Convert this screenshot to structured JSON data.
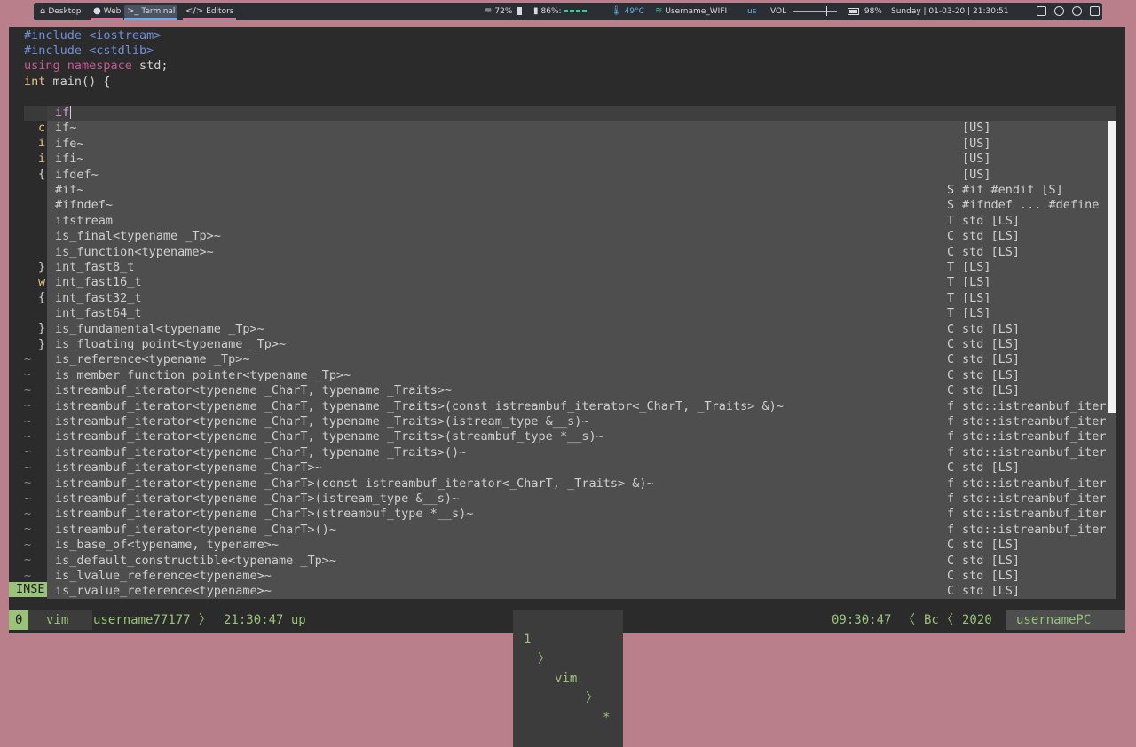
{
  "topbar": {
    "tags": [
      {
        "icon": "home-icon",
        "label": "Desktop",
        "underline": ""
      },
      {
        "icon": "globe-icon",
        "label": "Web",
        "underline": "#e06c9f"
      },
      {
        "icon": "terminal-icon",
        "label": "Terminal",
        "underline": "#61afef"
      },
      {
        "icon": "code-icon",
        "label": "Editors",
        "underline": "#e06c9f"
      }
    ],
    "disk": "72%",
    "memory": "86%:",
    "temperature": "49°C",
    "wifi": "Username_WIFI",
    "keyboard_layout": "us",
    "volume_label": "VOL",
    "battery": "98%",
    "datetime": "Sunday | 01-03-20 | 21:30:51"
  },
  "editor": {
    "lines": [
      {
        "a": "#include",
        "b": " <iostream>"
      },
      {
        "a": "#include",
        "b": " <cstdlib>"
      },
      {
        "a": "using",
        "ns": " namespace",
        "b": " std;"
      },
      {
        "a": "int",
        "b": " main() {"
      }
    ],
    "gutter": [
      "c",
      "i",
      "i",
      "{",
      "",
      "",
      "",
      "",
      "",
      "}",
      "w",
      "{",
      "",
      "}",
      "}",
      "~",
      "~",
      "~",
      "~",
      "~",
      "~",
      "~",
      "~",
      "~",
      "~",
      "~",
      "~",
      "~",
      "~",
      "~"
    ],
    "mode": "INSE"
  },
  "popup": {
    "typed": "if",
    "items": [
      {
        "word": "if~",
        "kind": "",
        "menu": "[US]"
      },
      {
        "word": "ife~",
        "kind": "",
        "menu": "[US]"
      },
      {
        "word": "ifi~",
        "kind": "",
        "menu": "[US]"
      },
      {
        "word": "ifdef~",
        "kind": "",
        "menu": "[US]"
      },
      {
        "word": "#if~",
        "kind": "S",
        "menu": "#if #endif [S]"
      },
      {
        "word": "#ifndef~",
        "kind": "S",
        "menu": "#ifndef ... #define"
      },
      {
        "word": "ifstream",
        "kind": "T",
        "menu": "std [LS]"
      },
      {
        "word": "is_final<typename _Tp>~",
        "kind": "C",
        "menu": "std [LS]"
      },
      {
        "word": "is_function<typename>~",
        "kind": "C",
        "menu": "std [LS]"
      },
      {
        "word": "int_fast8_t",
        "kind": "T",
        "menu": "[LS]"
      },
      {
        "word": "int_fast16_t",
        "kind": "T",
        "menu": "[LS]"
      },
      {
        "word": "int_fast32_t",
        "kind": "T",
        "menu": "[LS]"
      },
      {
        "word": "int_fast64_t",
        "kind": "T",
        "menu": "[LS]"
      },
      {
        "word": "is_fundamental<typename _Tp>~",
        "kind": "C",
        "menu": "std [LS]"
      },
      {
        "word": "is_floating_point<typename _Tp>~",
        "kind": "C",
        "menu": "std [LS]"
      },
      {
        "word": "is_reference<typename _Tp>~",
        "kind": "C",
        "menu": "std [LS]"
      },
      {
        "word": "is_member_function_pointer<typename _Tp>~",
        "kind": "C",
        "menu": "std [LS]"
      },
      {
        "word": "istreambuf_iterator<typename _CharT, typename _Traits>~",
        "kind": "C",
        "menu": "std [LS]"
      },
      {
        "word": "istreambuf_iterator<typename _CharT, typename _Traits>(const istreambuf_iterator<_CharT, _Traits> &)~",
        "kind": "f",
        "menu": "std::istreambuf_iter"
      },
      {
        "word": "istreambuf_iterator<typename _CharT, typename _Traits>(istream_type &__s)~",
        "kind": "f",
        "menu": "std::istreambuf_iter"
      },
      {
        "word": "istreambuf_iterator<typename _CharT, typename _Traits>(streambuf_type *__s)~",
        "kind": "f",
        "menu": "std::istreambuf_iter"
      },
      {
        "word": "istreambuf_iterator<typename _CharT, typename _Traits>()~",
        "kind": "f",
        "menu": "std::istreambuf_iter"
      },
      {
        "word": "istreambuf_iterator<typename _CharT>~",
        "kind": "C",
        "menu": "std [LS]"
      },
      {
        "word": "istreambuf_iterator<typename _CharT>(const istreambuf_iterator<_CharT, _Traits> &)~",
        "kind": "f",
        "menu": "std::istreambuf_iter"
      },
      {
        "word": "istreambuf_iterator<typename _CharT>(istream_type &__s)~",
        "kind": "f",
        "menu": "std::istreambuf_iter"
      },
      {
        "word": "istreambuf_iterator<typename _CharT>(streambuf_type *__s)~",
        "kind": "f",
        "menu": "std::istreambuf_iter"
      },
      {
        "word": "istreambuf_iterator<typename _CharT>()~",
        "kind": "f",
        "menu": "std::istreambuf_iter"
      },
      {
        "word": "is_base_of<typename, typename>~",
        "kind": "C",
        "menu": "std [LS]"
      },
      {
        "word": "is_default_constructible<typename _Tp>~",
        "kind": "C",
        "menu": "std [LS]"
      },
      {
        "word": "is_lvalue_reference<typename>~",
        "kind": "C",
        "menu": "std [LS]"
      },
      {
        "word": "is_rvalue_reference<typename>~",
        "kind": "C",
        "menu": "std [LS]"
      }
    ]
  },
  "status": {
    "window_index": "0",
    "window_name": "vim",
    "user": "username77177",
    "uptime": "21:30:47 up",
    "pane_index": "1",
    "pane_cmd": "vim",
    "pane_flag": "*",
    "clock": "09:30:47",
    "day": "Bc",
    "year": "2020",
    "host": "usernamePC"
  },
  "colors": {
    "accent_green": "#98c379",
    "popup_bg": "#4e4e4e",
    "terminal_bg": "#2b2b2b"
  }
}
